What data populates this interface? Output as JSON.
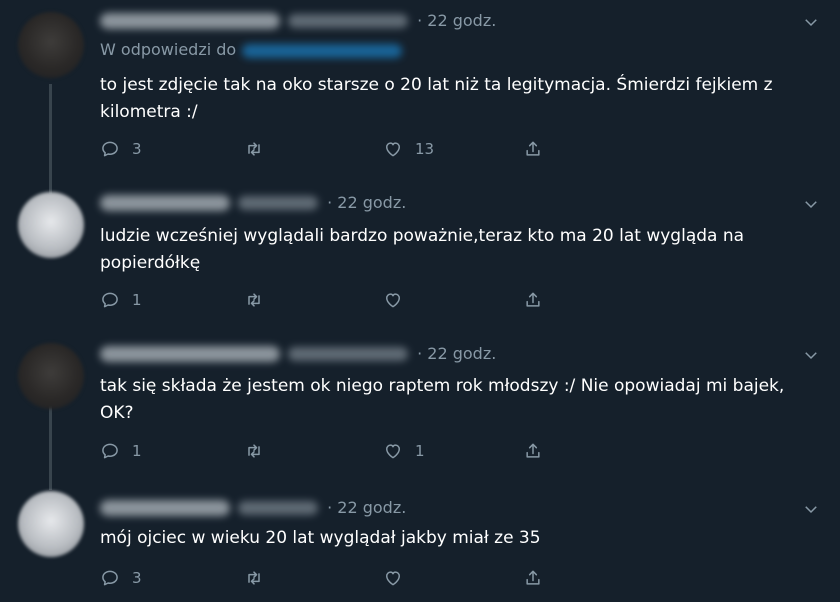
{
  "tweets": [
    {
      "time": "· 22 godz.",
      "reply_prefix": "W odpowiedzi do",
      "text": "to jest zdjęcie tak na oko starsze o 20 lat niż ta legitymacja. Śmierdzi fejkiem z kilometra :/",
      "replies": "3",
      "retweets": "",
      "likes": "13",
      "avatar": "dark"
    },
    {
      "time": "· 22 godz.",
      "text": "ludzie wcześniej wyglądali bardzo poważnie,teraz kto ma 20 lat wygląda na popierdółkę",
      "replies": "1",
      "retweets": "",
      "likes": "",
      "avatar": "light"
    },
    {
      "time": "· 22 godz.",
      "text": "tak się składa że jestem ok niego raptem rok młodszy :/ Nie opowiadaj mi bajek, OK?",
      "replies": "1",
      "retweets": "",
      "likes": "1",
      "avatar": "dark"
    },
    {
      "time": "· 22 godz.",
      "text": "mój ojciec w wieku 20 lat wyglądał jakby miał ze 35",
      "replies": "3",
      "retweets": "",
      "likes": "",
      "avatar": "light"
    }
  ],
  "icons": {
    "reply": "reply-icon",
    "retweet": "retweet-icon",
    "like": "heart-icon",
    "share": "share-icon",
    "menu": "chevron-down-icon"
  },
  "colors": {
    "background": "#15202b",
    "secondary_text": "#8899a6",
    "thread_line": "#38444d"
  }
}
